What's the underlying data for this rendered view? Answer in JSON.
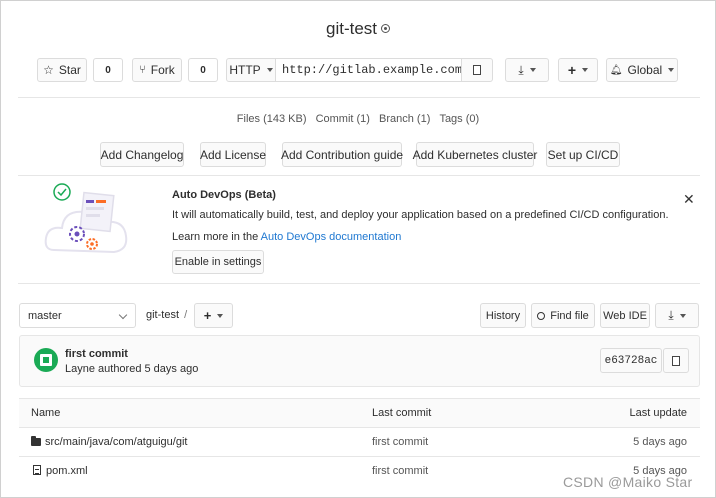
{
  "project": {
    "title": "git-test"
  },
  "toolbar": {
    "star_label": "Star",
    "star_count": "0",
    "fork_label": "Fork",
    "fork_count": "0",
    "protocol_label": "HTTP",
    "clone_url": "http://gitlab.example.com/roo",
    "notification_label": "Global"
  },
  "stats": {
    "files": "Files (143 KB)",
    "commits": "Commit (1)",
    "branches": "Branch (1)",
    "tags": "Tags (0)"
  },
  "quick_actions": [
    "Add Changelog",
    "Add License",
    "Add Contribution guide",
    "Add Kubernetes cluster",
    "Set up CI/CD"
  ],
  "devops": {
    "title": "Auto DevOps (Beta)",
    "description": "It will automatically build, test, and deploy your application based on a predefined CI/CD configuration.",
    "learn_prefix": "Learn more in the ",
    "learn_link": "Auto DevOps documentation",
    "enable_label": "Enable in settings"
  },
  "repo_nav": {
    "branch": "master",
    "breadcrumb": "git-test",
    "breadcrumb_sep": "/",
    "history_label": "History",
    "find_file_label": "Find file",
    "web_ide_label": "Web IDE"
  },
  "last_commit": {
    "title": "first commit",
    "meta": "Layne authored 5 days ago",
    "sha": "e63728ac"
  },
  "file_table": {
    "headers": {
      "name": "Name",
      "last_commit": "Last commit",
      "last_update": "Last update"
    },
    "rows": [
      {
        "name": "src/main/java/com/atguigu/git",
        "commit": "first commit",
        "updated": "5 days ago",
        "type": "folder"
      },
      {
        "name": "pom.xml",
        "commit": "first commit",
        "updated": "5 days ago",
        "type": "file"
      }
    ]
  },
  "watermark": "CSDN @Maiko Star",
  "colors": {
    "link": "#1f78d1",
    "avatar": "#1aaa55"
  },
  "icons": [
    "globe-icon",
    "star-icon",
    "fork-icon",
    "copy-icon",
    "download-icon",
    "plus-icon",
    "bell-icon",
    "close-icon",
    "search-icon",
    "folder-icon",
    "file-icon"
  ]
}
